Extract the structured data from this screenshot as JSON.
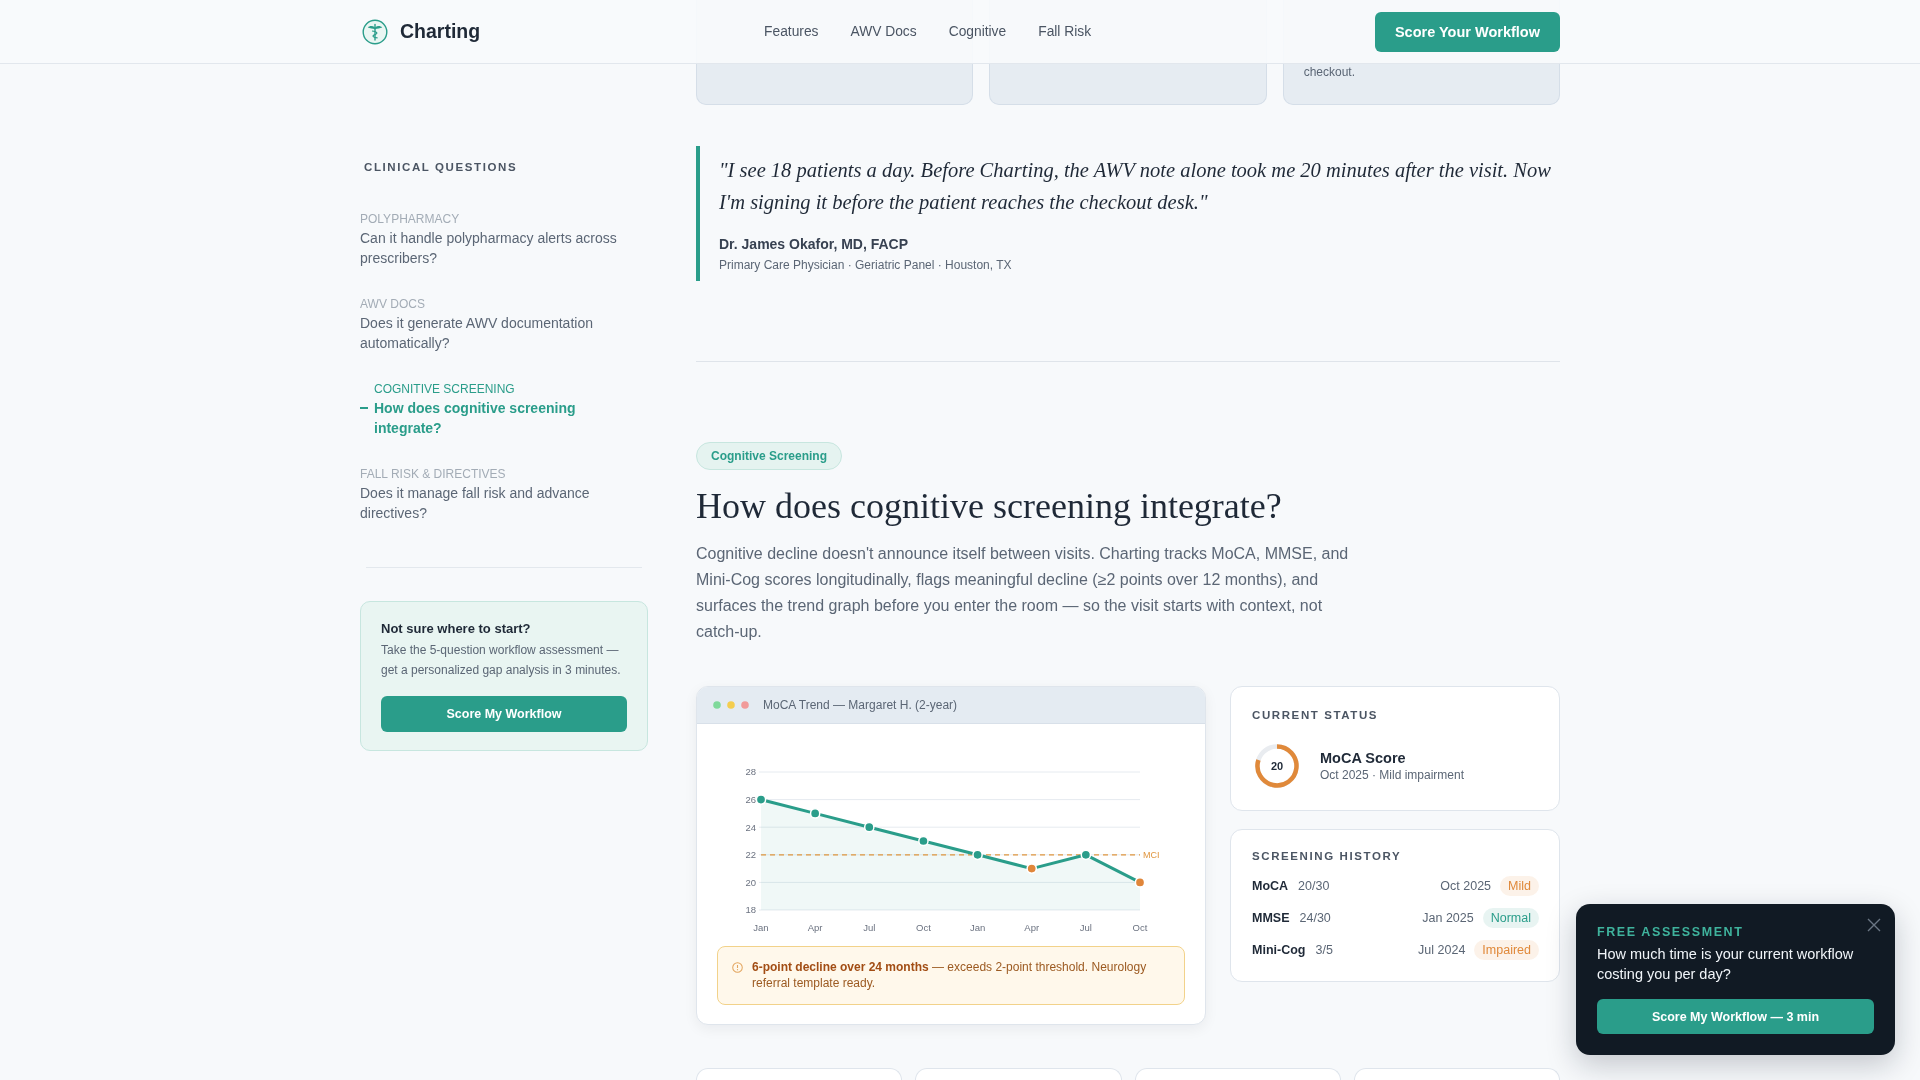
{
  "nav": {
    "brand": "Charting",
    "links": [
      "Features",
      "AWV Docs",
      "Cognitive",
      "Fall Risk"
    ],
    "cta": "Score Your Workflow"
  },
  "cards_above": [
    {
      "kind": "blank"
    },
    {
      "kind": "blank"
    },
    {
      "kind": "text",
      "text": "checkout."
    }
  ],
  "sidebar": {
    "title": "CLINICAL QUESTIONS",
    "items": [
      {
        "label": "POLYPHARMACY",
        "question": "Can it handle polypharmacy alerts across prescribers?",
        "selected": false
      },
      {
        "label": "AWV DOCS",
        "question": "Does it generate AWV documentation automatically?",
        "selected": false
      },
      {
        "label": "COGNITIVE SCREENING",
        "question": "How does cognitive screening integrate?",
        "selected": true
      },
      {
        "label": "FALL RISK & DIRECTIVES",
        "question": "Does it manage fall risk and advance directives?",
        "selected": false
      }
    ],
    "cta_card": {
      "title": "Not sure where to start?",
      "text": "Take the 5-question workflow assessment — get a personalized gap analysis in 3 minutes.",
      "button": "Score My Workflow"
    }
  },
  "testimonial": {
    "quote": "\"I see 18 patients a day. Before Charting, the AWV note alone took me 20 minutes after the visit. Now I'm signing it before the patient reaches the checkout desk.\"",
    "author": "Dr. James Okafor, MD, FACP",
    "role": "Primary Care Physician · Geriatric Panel · Houston, TX"
  },
  "section": {
    "badge": "Cognitive Screening",
    "heading": "How does cognitive screening integrate?",
    "body": "Cognitive decline doesn't announce itself between visits. Charting tracks MoCA, MMSE, and Mini-Cog scores longitudinally, flags meaningful decline (≥2 points over 12 months), and surfaces the trend graph before you enter the room — so the visit starts with context, not catch-up.",
    "trend_panel": {
      "title": "MoCA Trend — Margaret H. (2-year)",
      "chart_data": {
        "type": "area",
        "categories": [
          "Jan",
          "Apr",
          "Jul",
          "Oct",
          "Jan",
          "Apr",
          "Jul",
          "Oct"
        ],
        "values": [
          26,
          25,
          24,
          23,
          22,
          21,
          22,
          20
        ],
        "color": "#2a9d8a",
        "colors": [
          "#2a9d8a",
          "#2a9d8a",
          "#2a9d8a",
          "#2a9d8a",
          "#2a9d8a",
          "#e0863a",
          "#2a9d8a",
          "#e0863a"
        ],
        "ylim": [
          18,
          28
        ],
        "yticks": [
          18,
          20,
          22,
          24,
          26,
          28
        ],
        "ref_lines": [
          {
            "axis": "y",
            "value": 22,
            "label": "MCI",
            "color": "#e0963f",
            "line_style": "dashed"
          }
        ],
        "grid": true,
        "marker": "circle"
      },
      "alert": "**6-point decline over 24 months** — exceeds 2-point threshold. Neurology referral template ready."
    },
    "current_status": {
      "title": "CURRENT STATUS",
      "score": "20",
      "level": 0.8,
      "name": "MoCA Score",
      "detail": "Oct 2025 · Mild impairment"
    },
    "history": {
      "title": "SCREENING HISTORY",
      "rows": [
        {
          "test": "MoCA",
          "score": "20/30",
          "date": "Oct 2025",
          "status": "Mild",
          "color": "#e0893a"
        },
        {
          "test": "MMSE",
          "score": "24/30",
          "date": "Jan 2025",
          "status": "Normal",
          "color": "#2a9d8a"
        },
        {
          "test": "Mini-Cog",
          "score": "3/5",
          "date": "Jul 2024",
          "status": "Impaired",
          "color": "#e0893a"
        }
      ]
    }
  },
  "cards_below": [
    {
      "kind": "blank"
    },
    {
      "kind": "blank"
    },
    {
      "kind": "blank"
    },
    {
      "kind": "blank"
    }
  ],
  "popup": {
    "label": "FREE ASSESSMENT",
    "question": "How much time is your current workflow costing you per day?",
    "button": "Score My Workflow — 3 min"
  }
}
